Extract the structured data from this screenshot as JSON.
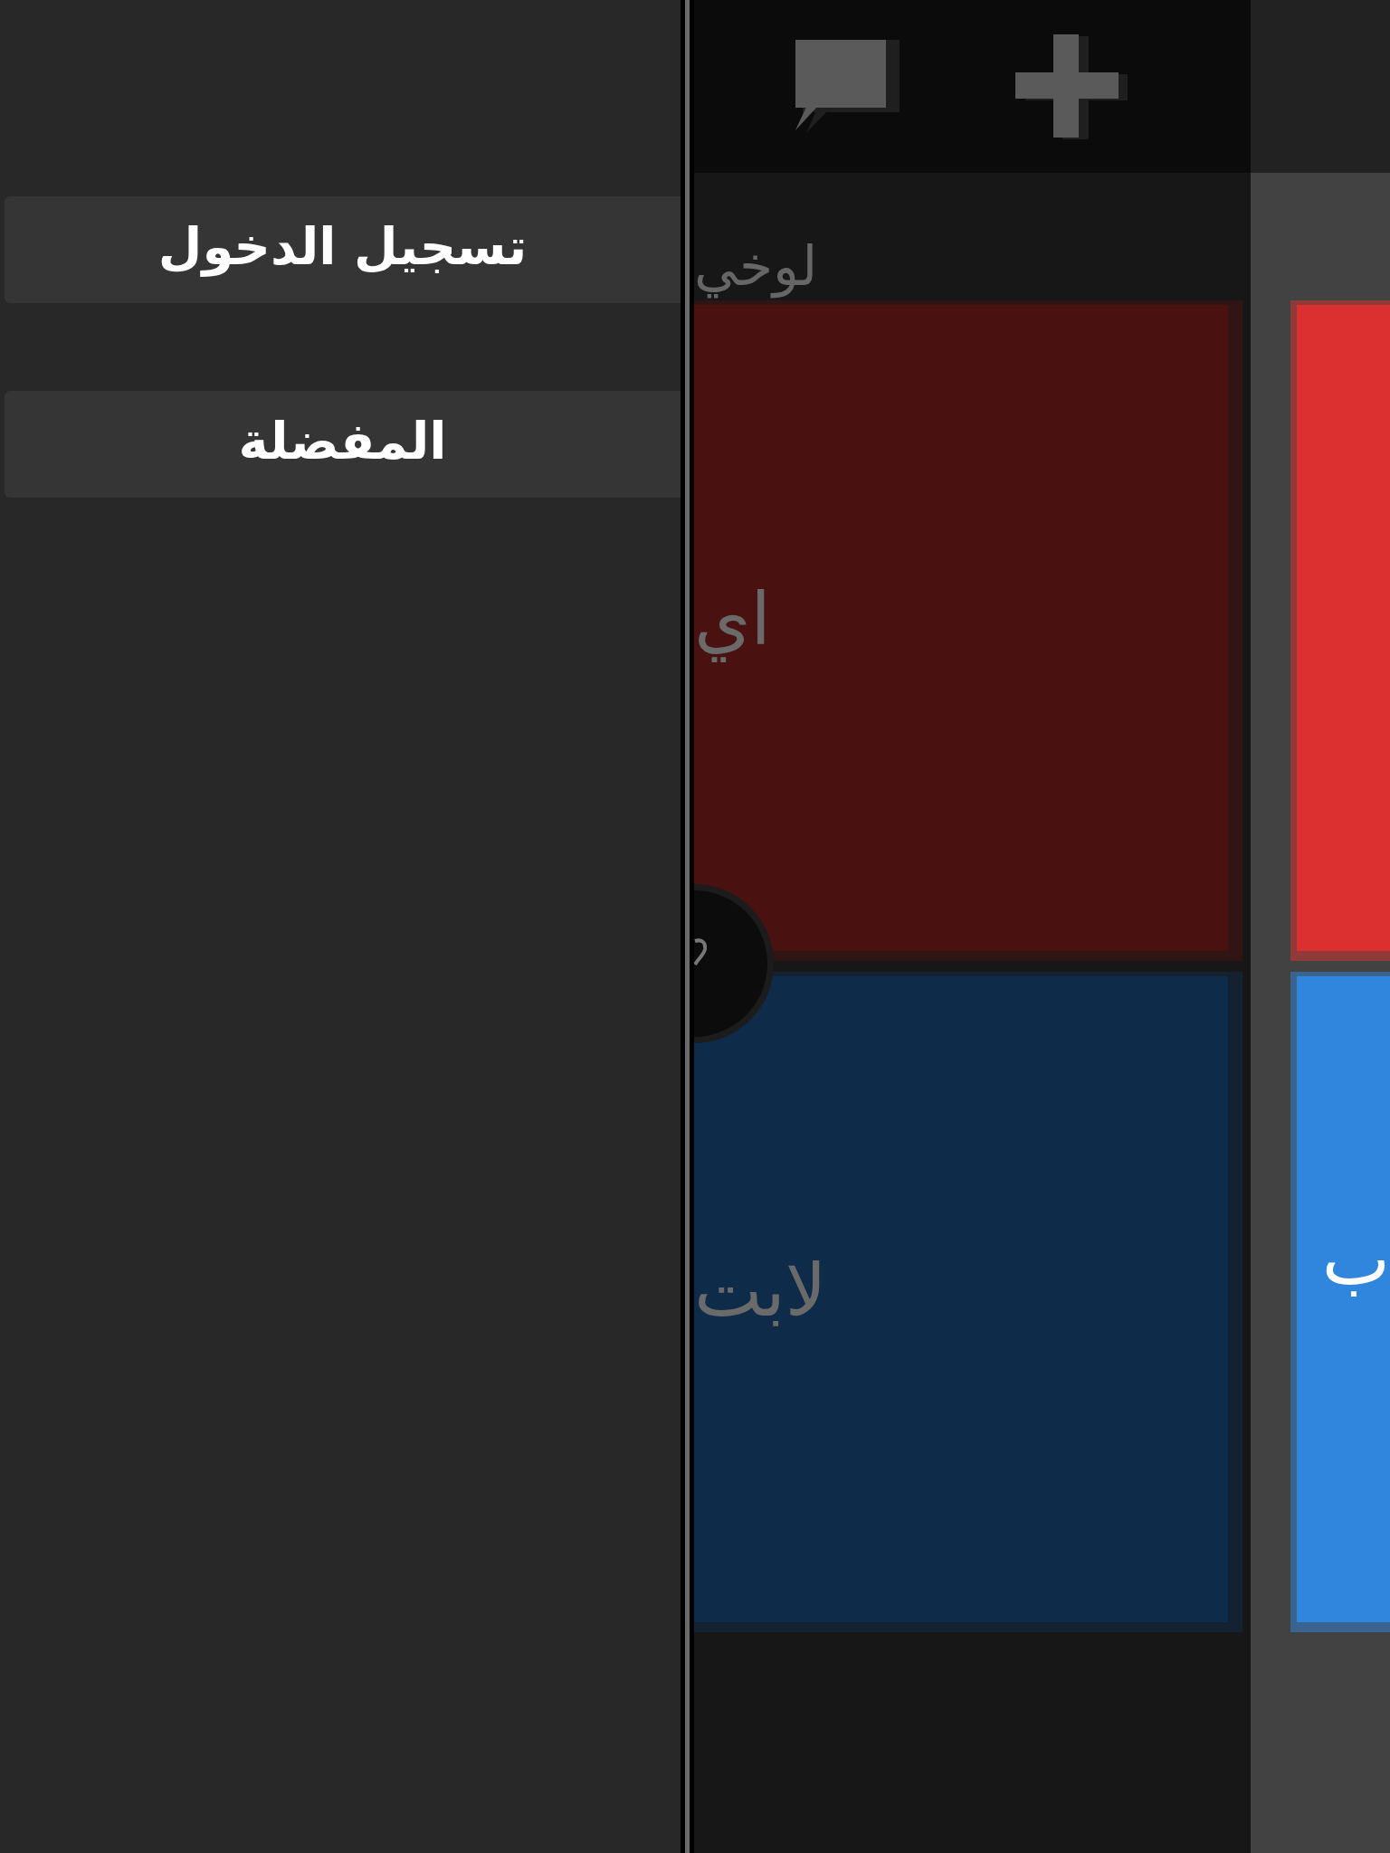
{
  "sidebar": {
    "items": [
      {
        "label": "تسجيل الدخول"
      },
      {
        "label": "المفضلة"
      }
    ]
  },
  "main": {
    "section_title": "لوخي",
    "tiles": [
      {
        "label": "اي",
        "color": "#4a1111"
      },
      {
        "label": "لابت",
        "color": "#0f2b4a"
      }
    ]
  },
  "side_column": {
    "tiles": [
      {
        "color": "#dc3030"
      },
      {
        "label": "ب",
        "color": "#3085dd"
      }
    ]
  }
}
